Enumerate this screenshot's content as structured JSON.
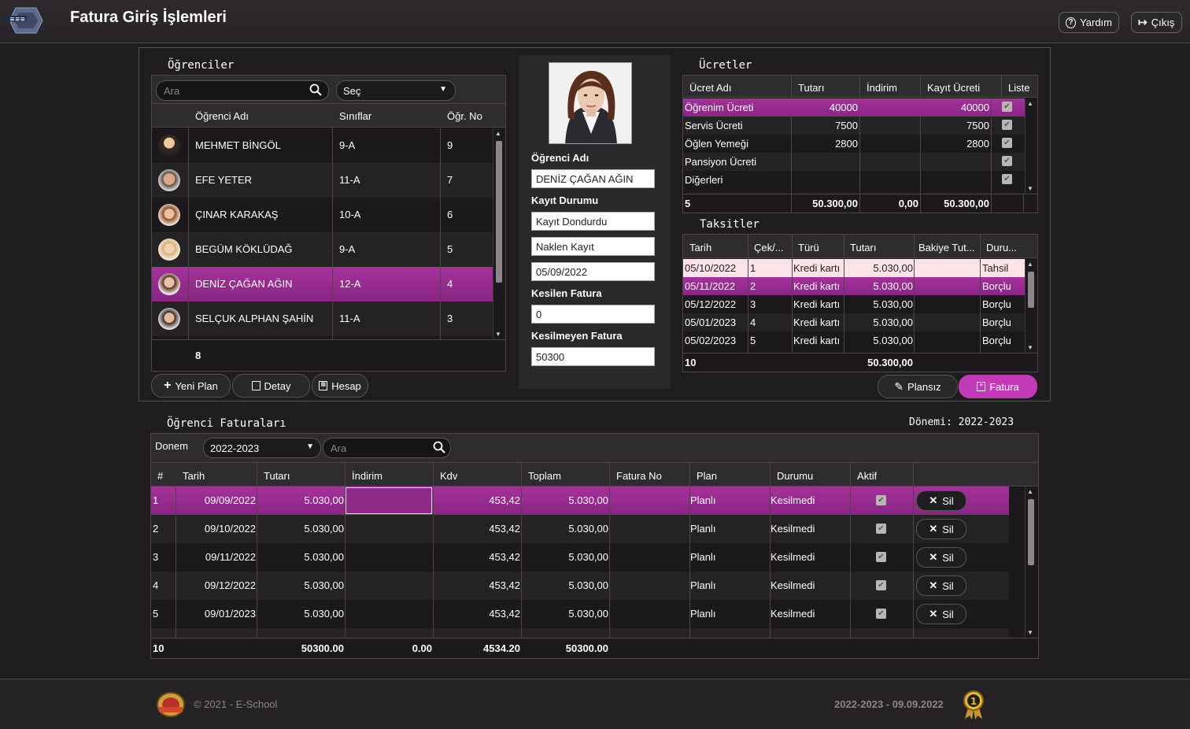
{
  "header": {
    "title": "Fatura Giriş İşlemleri",
    "help_label": "Yardım",
    "exit_label": "Çıkış"
  },
  "students": {
    "section_title": "Öğrenciler",
    "search_placeholder": "Ara",
    "class_select": "Seç",
    "columns": [
      "Öğrenci Adı",
      "Sınıflar",
      "Öğr. No"
    ],
    "rows": [
      {
        "name": "MEHMET BİNGÖL",
        "class": "9-A",
        "no": "9"
      },
      {
        "name": "EFE YETER",
        "class": "11-A",
        "no": "7"
      },
      {
        "name": "ÇINAR KARAKAŞ",
        "class": "10-A",
        "no": "6"
      },
      {
        "name": "BEGÜM KÖKLÜDAĞ",
        "class": "9-A",
        "no": "5"
      },
      {
        "name": "DENİZ ÇAĞAN AĞIN",
        "class": "12-A",
        "no": "4"
      },
      {
        "name": "SELÇUK ALPHAN ŞAHİN",
        "class": "11-A",
        "no": "3"
      }
    ],
    "total": "8",
    "buttons": {
      "new_plan": "Yeni Plan",
      "detail": "Detay",
      "account": "Hesap"
    }
  },
  "student_info": {
    "name_label": "Öğrenci Adı",
    "name_value": "DENİZ ÇAĞAN AĞIN",
    "status_label": "Kayıt Durumu",
    "status_value": "Kayıt Dondurdu",
    "type_value": "Naklen Kayıt",
    "date_value": "05/09/2022",
    "issued_label": "Kesilen Fatura",
    "issued_value": "0",
    "not_issued_label": "Kesilmeyen Fatura",
    "not_issued_value": "50300"
  },
  "fees": {
    "section_title": "Ücretler",
    "columns": [
      "Ücret Adı",
      "Tutarı",
      "İndirim",
      "Kayıt Ücreti",
      "Liste"
    ],
    "rows": [
      {
        "name": "Öğrenim Ücreti",
        "amount": "40000",
        "discount": "",
        "reg_fee": "40000"
      },
      {
        "name": "Servis Ücreti",
        "amount": "7500",
        "discount": "",
        "reg_fee": "7500"
      },
      {
        "name": "Öğlen Yemeği",
        "amount": "2800",
        "discount": "",
        "reg_fee": "2800"
      },
      {
        "name": "Pansiyon Ücreti",
        "amount": "",
        "discount": "",
        "reg_fee": ""
      },
      {
        "name": "Diğerleri",
        "amount": "",
        "discount": "",
        "reg_fee": ""
      }
    ],
    "totals": {
      "count": "5",
      "amount": "50.300,00",
      "discount": "0,00",
      "reg_fee": "50.300,00"
    }
  },
  "installments": {
    "section_title": "Taksitler",
    "columns": [
      "Tarih",
      "Çek/...",
      "Türü",
      "Tutarı",
      "Bakiye Tut...",
      "Duru..."
    ],
    "rows": [
      {
        "date": "05/10/2022",
        "no": "1",
        "type": "Kredi kartı",
        "amount": "5.030,00",
        "balance": "",
        "status": "Tahsil"
      },
      {
        "date": "05/11/2022",
        "no": "2",
        "type": "Kredi kartı",
        "amount": "5.030,00",
        "balance": "",
        "status": "Borçlu"
      },
      {
        "date": "05/12/2022",
        "no": "3",
        "type": "Kredi kartı",
        "amount": "5.030,00",
        "balance": "",
        "status": "Borçlu"
      },
      {
        "date": "05/01/2023",
        "no": "4",
        "type": "Kredi kartı",
        "amount": "5.030,00",
        "balance": "",
        "status": "Borçlu"
      },
      {
        "date": "05/02/2023",
        "no": "5",
        "type": "Kredi kartı",
        "amount": "5.030,00",
        "balance": "",
        "status": "Borçlu"
      }
    ],
    "totals": {
      "count": "10",
      "amount": "50.300,00"
    },
    "buttons": {
      "unplanned": "Plansız",
      "invoice": "Fatura"
    }
  },
  "invoices": {
    "section_title": "Öğrenci Faturaları",
    "period_text": "Dönemi: 2022-2023",
    "period_label": "Donem",
    "period_value": "2022-2023",
    "search_placeholder": "Ara",
    "columns": [
      "#",
      "Tarih",
      "Tutarı",
      "İndirim",
      "Kdv",
      "Toplam",
      "Fatura No",
      "Plan",
      "Durumu",
      "Aktif"
    ],
    "rows": [
      {
        "n": "1",
        "date": "09/09/2022",
        "amount": "5.030,00",
        "discount": "",
        "kdv": "453,42",
        "total": "5.030,00",
        "inv_no": "",
        "plan": "Planlı",
        "status": "Kesilmedi"
      },
      {
        "n": "2",
        "date": "09/10/2022",
        "amount": "5.030,00",
        "discount": "",
        "kdv": "453,42",
        "total": "5.030,00",
        "inv_no": "",
        "plan": "Planlı",
        "status": "Kesilmedi"
      },
      {
        "n": "3",
        "date": "09/11/2022",
        "amount": "5.030,00",
        "discount": "",
        "kdv": "453,42",
        "total": "5.030,00",
        "inv_no": "",
        "plan": "Planlı",
        "status": "Kesilmedi"
      },
      {
        "n": "4",
        "date": "09/12/2022",
        "amount": "5.030,00",
        "discount": "",
        "kdv": "453,42",
        "total": "5.030,00",
        "inv_no": "",
        "plan": "Planlı",
        "status": "Kesilmedi"
      },
      {
        "n": "5",
        "date": "09/01/2023",
        "amount": "5.030,00",
        "discount": "",
        "kdv": "453,42",
        "total": "5.030,00",
        "inv_no": "",
        "plan": "Planlı",
        "status": "Kesilmedi"
      }
    ],
    "delete_label": "Sil",
    "totals": {
      "count": "10",
      "amount": "50300.00",
      "discount": "0.00",
      "kdv": "4534.20",
      "total": "50300.00"
    }
  },
  "footer": {
    "copyright": "© 2021 - E-School",
    "period_date": "2022-2023 - 09.09.2022"
  },
  "colors": {
    "accent": "#a4329b",
    "background": "#1f1d1f",
    "highlight_row": "#fbe3e7"
  }
}
